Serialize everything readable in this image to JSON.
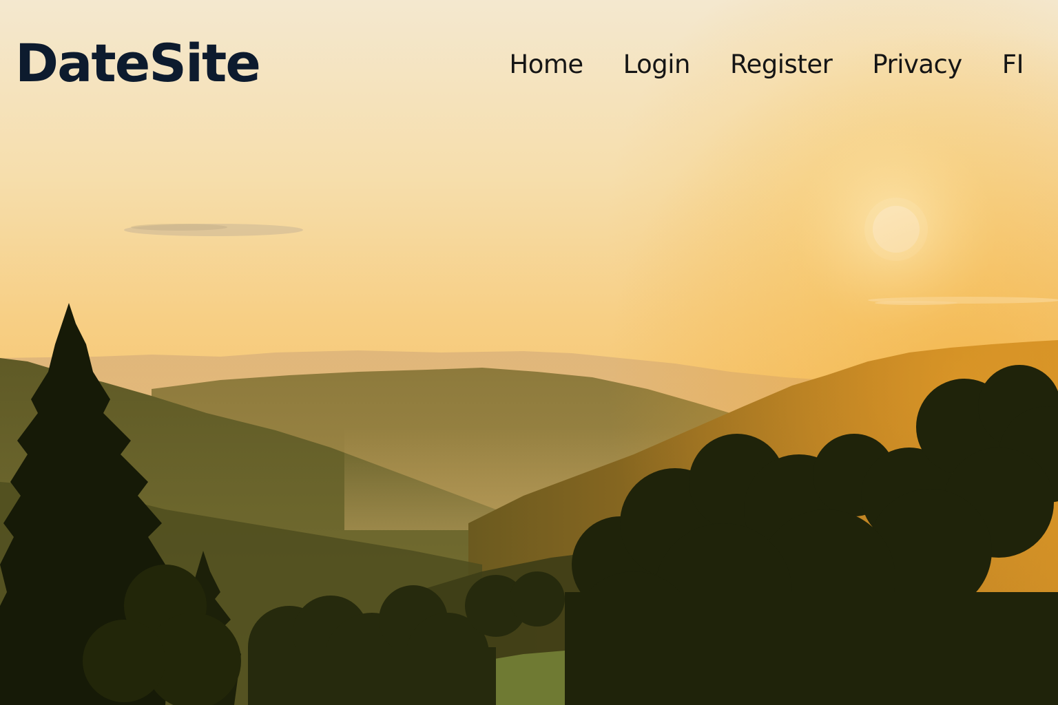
{
  "header": {
    "logo": "DateSite",
    "nav": [
      {
        "label": "Home"
      },
      {
        "label": "Login"
      },
      {
        "label": "Register"
      },
      {
        "label": "Privacy"
      },
      {
        "label": "FI"
      }
    ]
  },
  "hero": {
    "image": "sunset-over-forested-hills",
    "colors": {
      "sky_top": "#f4e8cf",
      "sky_horizon": "#f6c670",
      "sun": "#fffbe8",
      "foreground_trees": "#1a1d08"
    }
  }
}
